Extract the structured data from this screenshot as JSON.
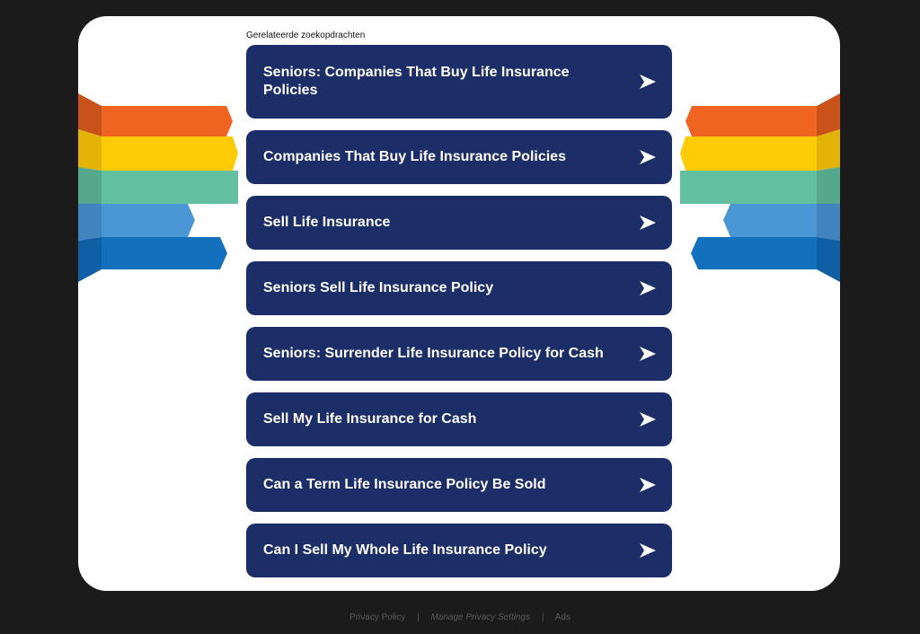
{
  "related": {
    "heading": "Gerelateerde zoekopdrachten",
    "links": [
      {
        "label": "Seniors: Companies That Buy Life Insurance Policies"
      },
      {
        "label": "Companies That Buy Life Insurance Policies"
      },
      {
        "label": "Sell Life Insurance"
      },
      {
        "label": "Seniors Sell Life Insurance Policy"
      },
      {
        "label": "Seniors: Surrender Life Insurance Policy for Cash"
      },
      {
        "label": "Sell My Life Insurance for Cash"
      },
      {
        "label": "Can a Term Life Insurance Policy Be Sold"
      },
      {
        "label": "Can I Sell My Whole Life Insurance Policy"
      }
    ],
    "link_icon": "arrow-right-icon",
    "button_color": "#1c2e67"
  },
  "decoration": {
    "ribbon_colors": [
      "#ee6420",
      "#fdcc07",
      "#62c0a0",
      "#4b97d6",
      "#1370bd"
    ]
  },
  "footer": {
    "privacy_policy": "Privacy Policy",
    "separator": "|",
    "manage_privacy": "Manage Privacy Settings",
    "ads": "Ads"
  }
}
